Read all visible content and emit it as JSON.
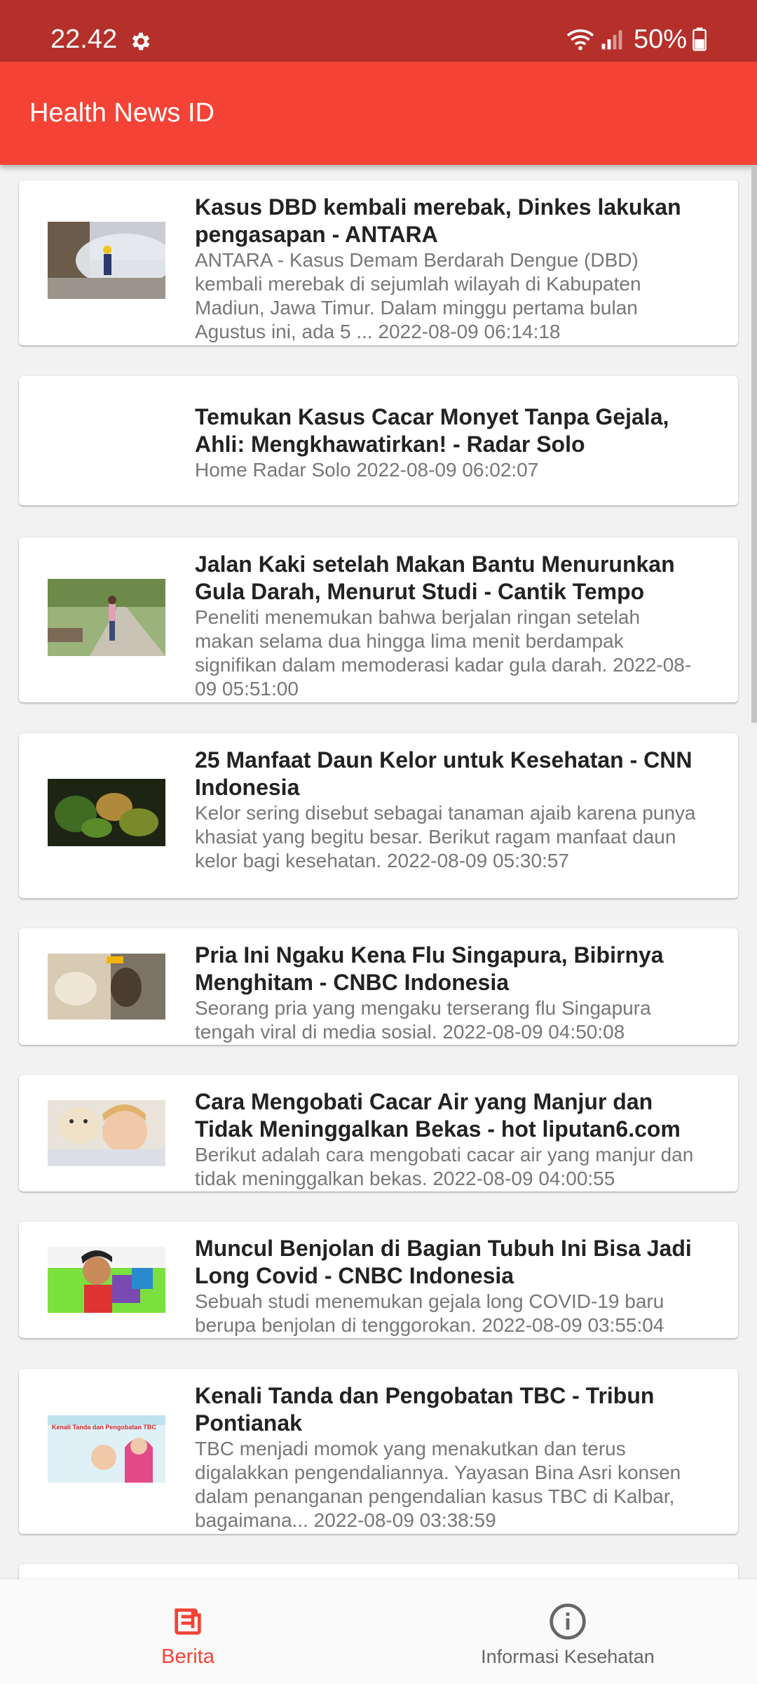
{
  "status_bar": {
    "time": "22.42",
    "battery": "50%",
    "icons": [
      "gear-icon",
      "wifi-icon",
      "signal-icon",
      "battery-icon"
    ]
  },
  "app_bar": {
    "title": "Health News ID"
  },
  "news": [
    {
      "title": "Kasus DBD kembali merebak, Dinkes lakukan pengasapan - ANTARA",
      "desc": "ANTARA - Kasus Demam Berdarah Dengue (DBD) kembali merebak di sejumlah wilayah di Kabupaten Madiun, Jawa Timur. Dalam minggu pertama bulan Agustus ini, ada 5 ...  2022-08-09 06:14:18"
    },
    {
      "title": "Temukan Kasus Cacar Monyet Tanpa Gejala, Ahli: Mengkhawatirkan! - Radar Solo",
      "desc": "Home Radar Solo  2022-08-09 06:02:07"
    },
    {
      "title": "Jalan Kaki setelah Makan Bantu Menurunkan Gula Darah, Menurut Studi - Cantik Tempo",
      "desc": "Peneliti menemukan bahwa berjalan ringan setelah makan selama dua hingga lima menit berdampak signifikan dalam memoderasi kadar gula darah.  2022-08-09 05:51:00"
    },
    {
      "title": "25 Manfaat Daun Kelor untuk Kesehatan - CNN Indonesia",
      "desc": "Kelor sering disebut sebagai tanaman ajaib karena punya khasiat yang begitu besar. Berikut ragam manfaat daun kelor bagi kesehatan.  2022-08-09 05:30:57"
    },
    {
      "title": "Pria Ini Ngaku Kena Flu Singapura, Bibirnya Menghitam - CNBC Indonesia",
      "desc": "Seorang pria yang mengaku terserang flu Singapura tengah viral di media sosial.  2022-08-09 04:50:08"
    },
    {
      "title": "Cara Mengobati Cacar Air yang Manjur dan Tidak Meninggalkan Bekas - hot liputan6.com",
      "desc": "Berikut adalah cara mengobati cacar air yang manjur dan tidak meninggalkan bekas.  2022-08-09 04:00:55"
    },
    {
      "title": "Muncul Benjolan di Bagian Tubuh Ini Bisa Jadi Long Covid - CNBC Indonesia",
      "desc": "Sebuah studi menemukan gejala long COVID-19 baru berupa benjolan di tenggorokan.  2022-08-09 03:55:04"
    },
    {
      "title": "Kenali Tanda dan Pengobatan TBC - Tribun Pontianak",
      "desc": "TBC menjadi momok yang menakutkan dan terus digalakkan pengendaliannya. Yayasan Bina Asri konsen dalam penanganan pengendalian kasus TBC di Kalbar, bagaimana...  2022-08-09 03:38:59"
    }
  ],
  "thumbnail_texts": {
    "tbc": "Kenali Tanda dan Pengobatan TBC"
  },
  "bottom_nav": {
    "berita": "Berita",
    "info": "Informasi Kesehatan",
    "active": "Berita",
    "active_color": "#f44336"
  },
  "colors": {
    "status_bar": "#b5302a",
    "app_bar": "#f44336"
  }
}
